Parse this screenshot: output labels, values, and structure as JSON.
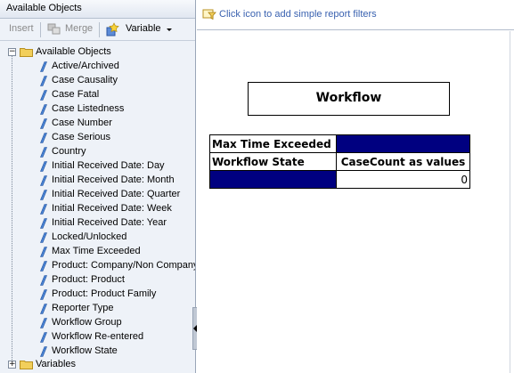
{
  "left_panel": {
    "title": "Available Objects",
    "toolbar": {
      "insert_label": "Insert",
      "merge_label": "Merge",
      "variable_label": "Variable"
    },
    "tree": {
      "root_label": "Available Objects",
      "root_expander": "−",
      "items": [
        "Active/Archived",
        "Case Causality",
        "Case Fatal",
        "Case Listedness",
        "Case Number",
        "Case Serious",
        "Country",
        "Initial Received Date: Day",
        "Initial Received Date: Month",
        "Initial Received Date: Quarter",
        "Initial Received Date: Week",
        "Initial Received Date: Year",
        "Locked/Unlocked",
        "Max Time Exceeded",
        "Product: Company/Non Company",
        "Product: Product",
        "Product: Product Family",
        "Reporter Type",
        "Workflow Group",
        "Workflow Re-entered",
        "Workflow State"
      ],
      "variables_label": "Variables",
      "variables_expander": "+"
    }
  },
  "filter_bar": {
    "text": "Click icon to add simple report filters"
  },
  "report": {
    "title": "Workflow",
    "crosstab": {
      "filter_label": "Max Time Exceeded",
      "row_header": "Workflow State",
      "column_header": "CaseCount as values",
      "value": "0"
    }
  },
  "colors": {
    "navy_fill": "#000080",
    "filter_text": "#3a62b0",
    "panel_bg": "#eef2f8",
    "folder": "#f2cf5b"
  },
  "icons": {
    "dimension": "blue-dimension-icon",
    "folder": "folder-icon",
    "filter": "filter-icon",
    "variable": "variable-icon",
    "merge": "merge-icon"
  }
}
